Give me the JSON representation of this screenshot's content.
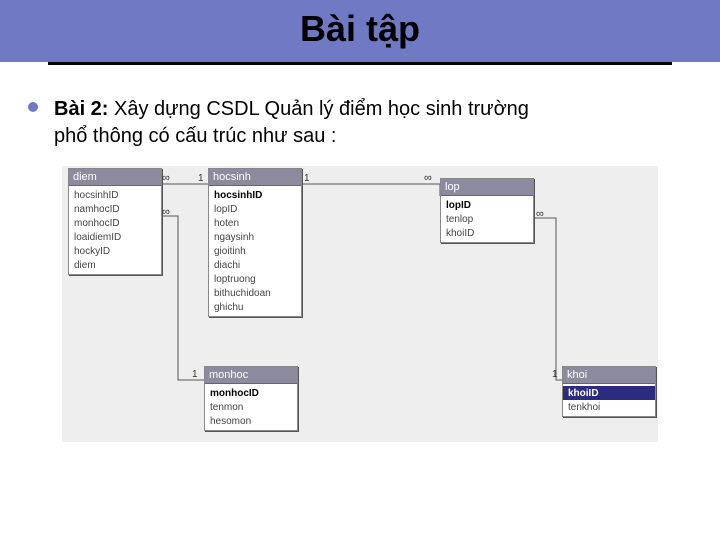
{
  "title": "Bài tập",
  "bullet_lead": "Bài 2:",
  "bullet_text_1": " Xây dựng CSDL Quản lý điểm học sinh trường",
  "bullet_text_2": "phổ thông có cấu trúc như sau :",
  "tables": {
    "diem": {
      "title": "diem",
      "fields": [
        "hocsinhID",
        "namhocID",
        "monhocID",
        "loaidiemID",
        "hockyID",
        "diem"
      ],
      "pk_index": -1,
      "sel_index": -1
    },
    "hocsinh": {
      "title": "hocsinh",
      "fields": [
        "hocsinhID",
        "lopID",
        "hoten",
        "ngaysinh",
        "gioitinh",
        "diachi",
        "loptruong",
        "bithuchidoan",
        "ghichu"
      ],
      "pk_index": 0,
      "sel_index": -1
    },
    "lop": {
      "title": "lop",
      "fields": [
        "lopID",
        "tenlop",
        "khoiID"
      ],
      "pk_index": 0,
      "sel_index": -1
    },
    "monhoc": {
      "title": "monhoc",
      "fields": [
        "monhocID",
        "tenmon",
        "hesomon"
      ],
      "pk_index": 0,
      "sel_index": -1
    },
    "khoi": {
      "title": "khoi",
      "fields": [
        "khoiID",
        "tenkhoi"
      ],
      "pk_index": -1,
      "sel_index": 0
    }
  },
  "cardinality": {
    "one": "1",
    "many": "∞"
  }
}
